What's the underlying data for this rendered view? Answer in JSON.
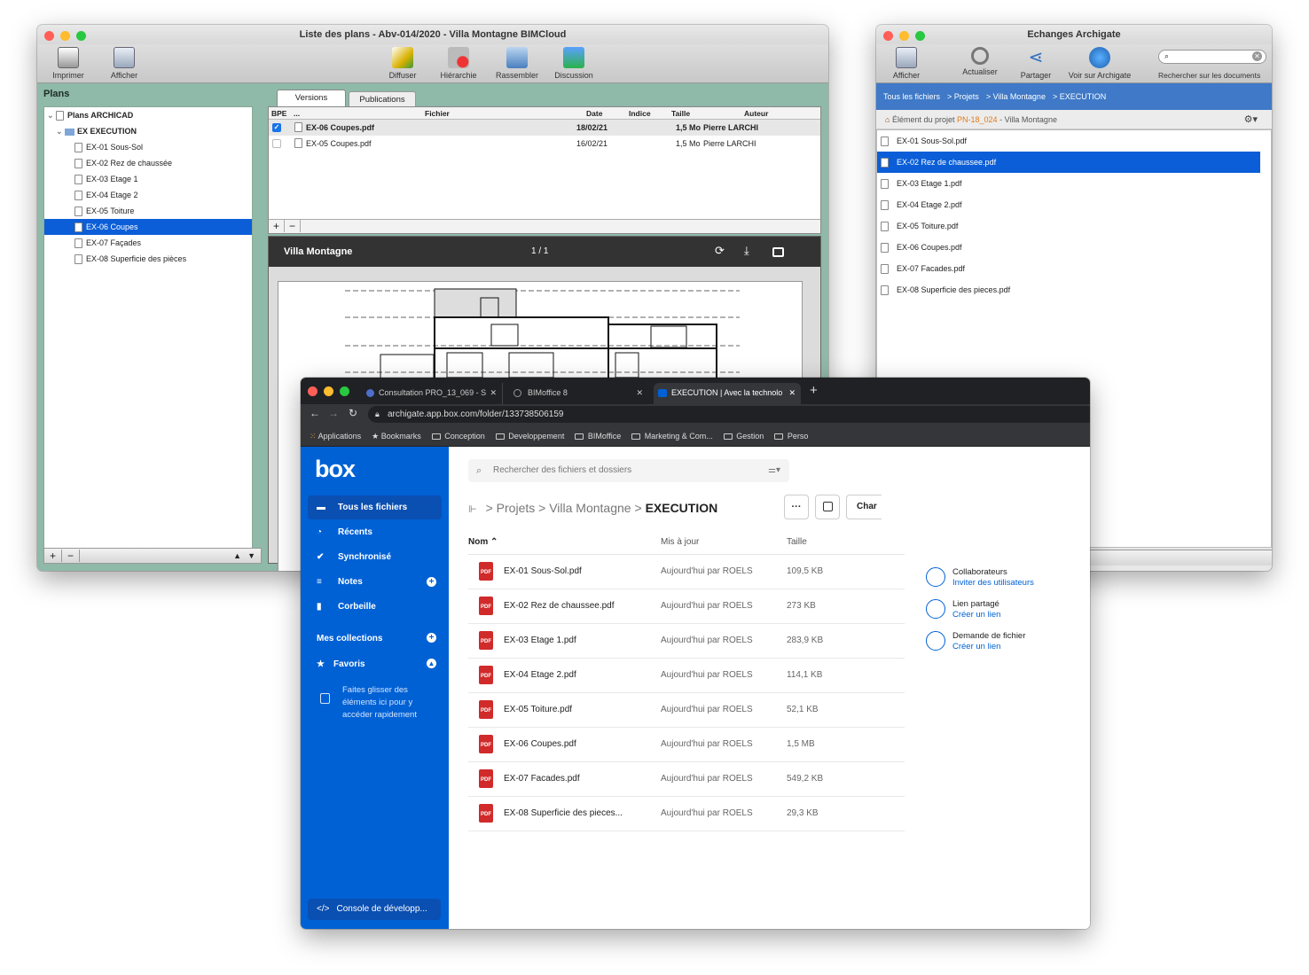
{
  "plans_window": {
    "title": "Liste des plans - Abv-014/2020 - Villa Montagne BIMCloud",
    "toolbar": {
      "print": "Imprimer",
      "show": "Afficher",
      "distribute": "Diffuser",
      "hierarchy": "Hiérarchie",
      "gather": "Rassembler",
      "discussion": "Discussion"
    },
    "sidebar_title": "Plans",
    "tree_root": "Plans ARCHICAD",
    "tree_folder": "EX EXECUTION",
    "tree_items": [
      "EX-01 Sous-Sol",
      "EX-02 Rez de chaussée",
      "EX-03 Etage 1",
      "EX-04 Etage 2",
      "EX-05 Toiture",
      "EX-06 Coupes",
      "EX-07 Façades",
      "EX-08 Superficie des pièces"
    ],
    "tabs": {
      "versions": "Versions",
      "publications": "Publications"
    },
    "columns": {
      "bpe": "BPE",
      "dots": "...",
      "file": "Fichier",
      "date": "Date",
      "index": "Indice",
      "size": "Taille",
      "author": "Auteur"
    },
    "rows": [
      {
        "file": "EX-06 Coupes.pdf",
        "date": "18/02/21",
        "size": "1,5 Mo",
        "author": "Pierre LARCHI",
        "checked": true
      },
      {
        "file": "EX-05 Coupes.pdf",
        "date": "16/02/21",
        "size": "1,5 Mo",
        "author": "Pierre LARCHI",
        "checked": false
      }
    ],
    "plus": "+",
    "minus": "−",
    "viewer": {
      "title": "Villa Montagne",
      "pages": "1 / 1"
    }
  },
  "archigate_window": {
    "title": "Echanges Archigate",
    "toolbar": {
      "show": "Afficher",
      "refresh": "Actualiser",
      "share": "Partager",
      "view": "Voir sur Archigate",
      "search_label": "Rechercher sur les documents"
    },
    "breadcrumb": [
      "Tous les fichiers",
      "> Projets",
      "> Villa Montagne",
      "> EXECUTION"
    ],
    "project_prefix": "Élément du projet",
    "project_code": "PN-18_024",
    "project_suffix": "- Villa Montagne",
    "files": [
      "EX-01 Sous-Sol.pdf",
      "EX-02 Rez de chaussee.pdf",
      "EX-03 Etage 1.pdf",
      "EX-04 Etage 2.pdf",
      "EX-05 Toiture.pdf",
      "EX-06 Coupes.pdf",
      "EX-07 Facades.pdf",
      "EX-08 Superficie des pieces.pdf"
    ],
    "plus": "+",
    "minus": "−"
  },
  "browser": {
    "tabs": [
      "Consultation PRO_13_069 - S",
      "BIMoffice 8",
      "EXECUTION | Avec la technolo"
    ],
    "new_tab": "+",
    "url": "archigate.app.box.com/folder/133738506159",
    "bookmarks": [
      "Applications",
      "Bookmarks",
      "Conception",
      "Developpement",
      "BIMoffice",
      "Marketing & Com...",
      "Gestion",
      "Perso"
    ]
  },
  "box": {
    "logo": "box",
    "search_placeholder": "Rechercher des fichiers et dossiers",
    "nav": [
      {
        "label": "Tous les fichiers"
      },
      {
        "label": "Récents"
      },
      {
        "label": "Synchronisé"
      },
      {
        "label": "Notes"
      },
      {
        "label": "Corbeille"
      }
    ],
    "collections": "Mes collections",
    "favorites": "Favoris",
    "drag_hint": "Faites glisser des éléments ici pour y accéder rapidement",
    "console": "Console de développ...",
    "breadcrumb": {
      "projects": "Projets",
      "villa": "Villa Montagne",
      "current": "EXECUTION"
    },
    "more": "···",
    "char_button": "Char",
    "columns": {
      "name": "Nom",
      "updated": "Mis à jour",
      "size": "Taille"
    },
    "files": [
      {
        "name": "EX-01 Sous-Sol.pdf",
        "updated": "Aujourd'hui par ROELS",
        "size": "109,5 KB"
      },
      {
        "name": "EX-02 Rez de chaussee.pdf",
        "updated": "Aujourd'hui par ROELS",
        "size": "273 KB"
      },
      {
        "name": "EX-03 Etage 1.pdf",
        "updated": "Aujourd'hui par ROELS",
        "size": "283,9 KB"
      },
      {
        "name": "EX-04 Etage 2.pdf",
        "updated": "Aujourd'hui par ROELS",
        "size": "114,1 KB"
      },
      {
        "name": "EX-05 Toiture.pdf",
        "updated": "Aujourd'hui par ROELS",
        "size": "52,1 KB"
      },
      {
        "name": "EX-06 Coupes.pdf",
        "updated": "Aujourd'hui par ROELS",
        "size": "1,5 MB"
      },
      {
        "name": "EX-07 Facades.pdf",
        "updated": "Aujourd'hui par ROELS",
        "size": "549,2 KB"
      },
      {
        "name": "EX-08 Superficie des pieces...",
        "updated": "Aujourd'hui par ROELS",
        "size": "29,3 KB"
      }
    ],
    "right_panel": {
      "collaborators": "Collaborateurs",
      "invite": "Inviter des utilisateurs",
      "shared_link": "Lien partagé",
      "create_link": "Créer un lien",
      "file_request": "Demande de fichier",
      "create_link2": "Créer un lien"
    },
    "colors": {
      "accent": "#0061d5",
      "sidebar": "#0061d5"
    }
  }
}
